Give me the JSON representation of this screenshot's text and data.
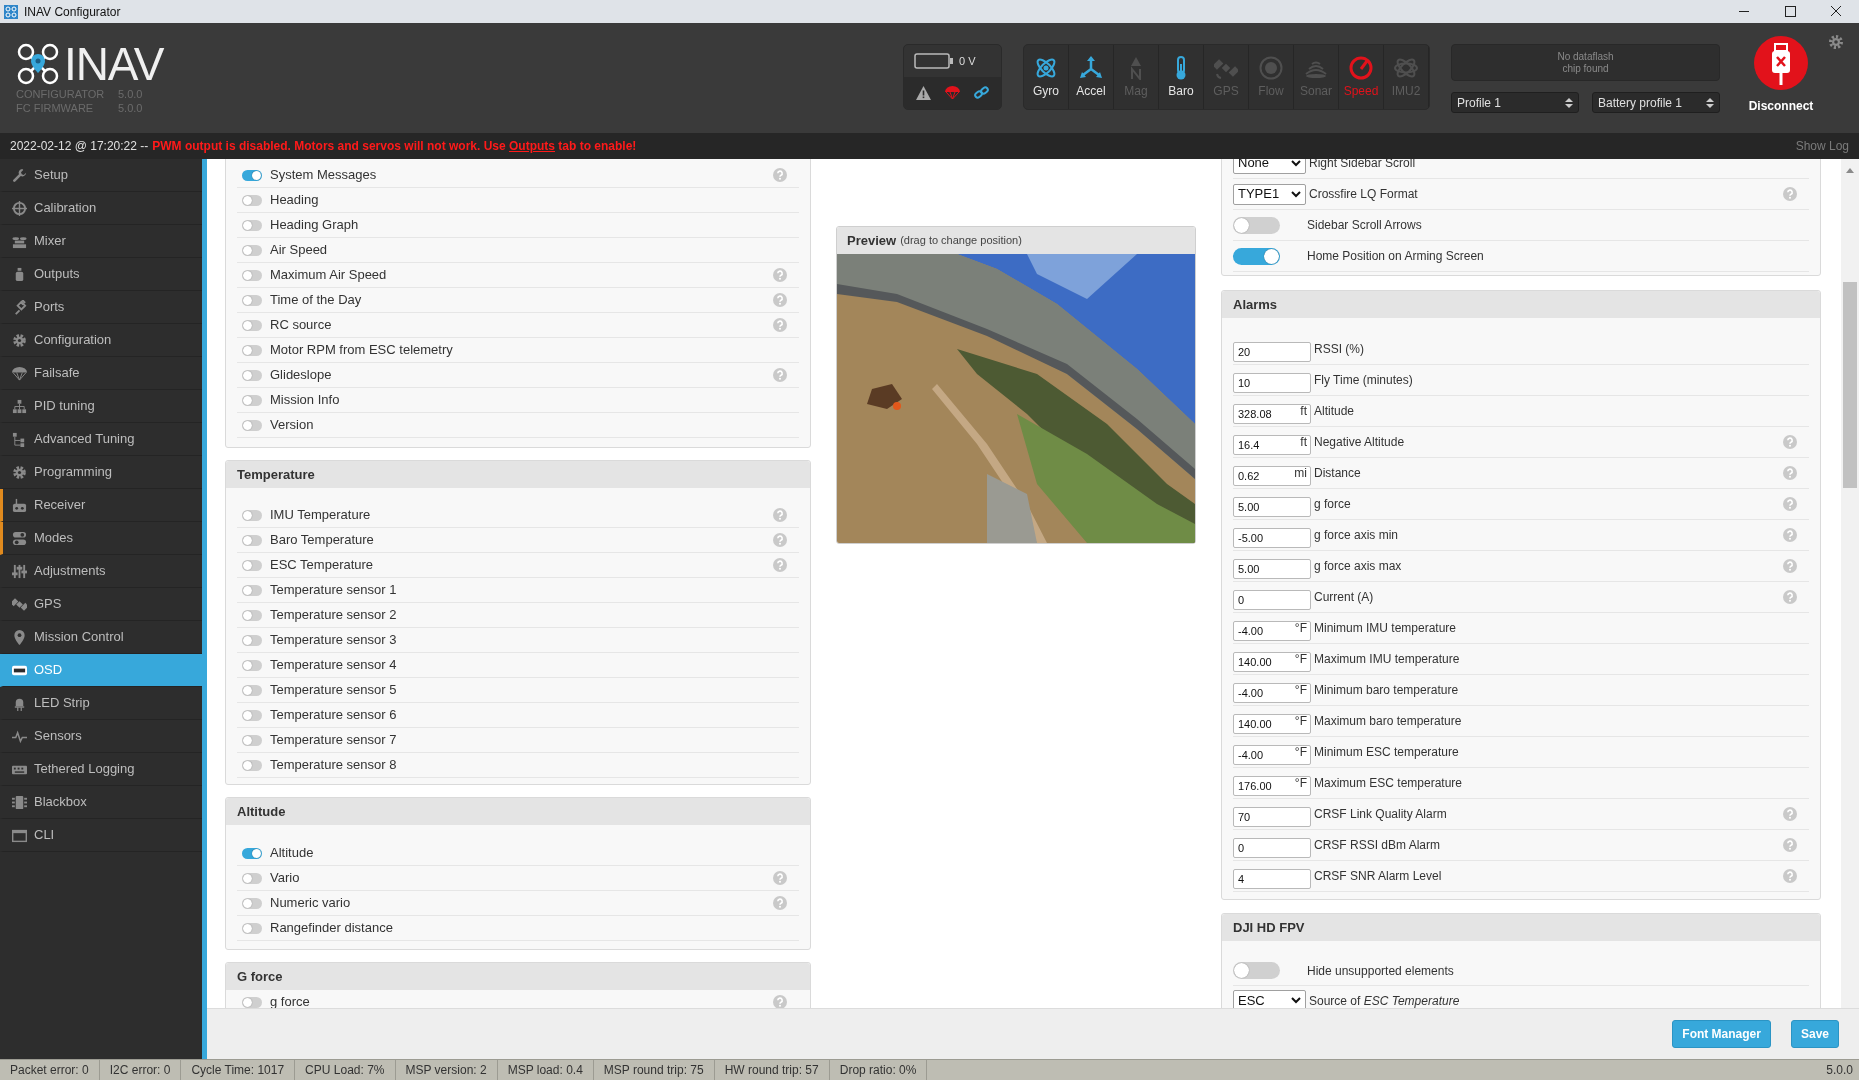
{
  "window": {
    "title": "INAV Configurator"
  },
  "header": {
    "logo_text": "INAV",
    "versions": [
      {
        "label": "CONFIGURATOR",
        "value": "5.0.0"
      },
      {
        "label": "FC FIRMWARE",
        "value": "5.0.0"
      }
    ],
    "battery": {
      "voltage": "0 V"
    },
    "sensors": [
      {
        "label": "Gyro",
        "enabled": true,
        "alert": false
      },
      {
        "label": "Accel",
        "enabled": true,
        "alert": false
      },
      {
        "label": "Mag",
        "enabled": false,
        "alert": false
      },
      {
        "label": "Baro",
        "enabled": true,
        "alert": false
      },
      {
        "label": "GPS",
        "enabled": false,
        "alert": false
      },
      {
        "label": "Flow",
        "enabled": false,
        "alert": false
      },
      {
        "label": "Sonar",
        "enabled": false,
        "alert": false
      },
      {
        "label": "Speed",
        "enabled": true,
        "alert": true
      },
      {
        "label": "IMU2",
        "enabled": false,
        "alert": false
      }
    ],
    "dataflash": "No dataflash chip found",
    "profiles": [
      "Profile 1",
      "Battery profile 1"
    ],
    "disconnect": "Disconnect"
  },
  "log": {
    "time": "2022-02-12 @ 17:20:22 --",
    "message_before": "PWM output is disabled. Motors and servos will not work. Use",
    "link": "Outputs",
    "message_after": "tab to enable!",
    "show_log": "Show Log"
  },
  "sidebar": {
    "items": [
      {
        "label": "Setup",
        "selected": false,
        "flag": false
      },
      {
        "label": "Calibration",
        "selected": false,
        "flag": false
      },
      {
        "label": "Mixer",
        "selected": false,
        "flag": false
      },
      {
        "label": "Outputs",
        "selected": false,
        "flag": false
      },
      {
        "label": "Ports",
        "selected": false,
        "flag": false
      },
      {
        "label": "Configuration",
        "selected": false,
        "flag": false
      },
      {
        "label": "Failsafe",
        "selected": false,
        "flag": false
      },
      {
        "label": "PID tuning",
        "selected": false,
        "flag": false
      },
      {
        "label": "Advanced Tuning",
        "selected": false,
        "flag": false
      },
      {
        "label": "Programming",
        "selected": false,
        "flag": false
      },
      {
        "label": "Receiver",
        "selected": false,
        "flag": true
      },
      {
        "label": "Modes",
        "selected": false,
        "flag": true
      },
      {
        "label": "Adjustments",
        "selected": false,
        "flag": false
      },
      {
        "label": "GPS",
        "selected": false,
        "flag": false
      },
      {
        "label": "Mission Control",
        "selected": false,
        "flag": false
      },
      {
        "label": "OSD",
        "selected": true,
        "flag": false
      },
      {
        "label": "LED Strip",
        "selected": false,
        "flag": false
      },
      {
        "label": "Sensors",
        "selected": false,
        "flag": false
      },
      {
        "label": "Tethered Logging",
        "selected": false,
        "flag": false
      },
      {
        "label": "Blackbox",
        "selected": false,
        "flag": false
      },
      {
        "label": "CLI",
        "selected": false,
        "flag": false
      }
    ]
  },
  "element_groups": [
    {
      "items": [
        {
          "label": "System Messages",
          "on": true,
          "help": true
        },
        {
          "label": "Heading",
          "on": false,
          "help": false
        },
        {
          "label": "Heading Graph",
          "on": false,
          "help": false
        },
        {
          "label": "Air Speed",
          "on": false,
          "help": false
        },
        {
          "label": "Maximum Air Speed",
          "on": false,
          "help": true
        },
        {
          "label": "Time of the Day",
          "on": false,
          "help": true
        },
        {
          "label": "RC source",
          "on": false,
          "help": true
        },
        {
          "label": "Motor RPM from ESC telemetry",
          "on": false,
          "help": false
        },
        {
          "label": "Glideslope",
          "on": false,
          "help": true
        },
        {
          "label": "Mission Info",
          "on": false,
          "help": false
        },
        {
          "label": "Version",
          "on": false,
          "help": false
        }
      ]
    },
    {
      "title": "Temperature",
      "items": [
        {
          "label": "IMU Temperature",
          "on": false,
          "help": true
        },
        {
          "label": "Baro Temperature",
          "on": false,
          "help": true
        },
        {
          "label": "ESC Temperature",
          "on": false,
          "help": true
        },
        {
          "label": "Temperature sensor 1",
          "on": false,
          "help": false
        },
        {
          "label": "Temperature sensor 2",
          "on": false,
          "help": false
        },
        {
          "label": "Temperature sensor 3",
          "on": false,
          "help": false
        },
        {
          "label": "Temperature sensor 4",
          "on": false,
          "help": false
        },
        {
          "label": "Temperature sensor 5",
          "on": false,
          "help": false
        },
        {
          "label": "Temperature sensor 6",
          "on": false,
          "help": false
        },
        {
          "label": "Temperature sensor 7",
          "on": false,
          "help": false
        },
        {
          "label": "Temperature sensor 8",
          "on": false,
          "help": false
        }
      ]
    },
    {
      "title": "Altitude",
      "items": [
        {
          "label": "Altitude",
          "on": true,
          "help": false
        },
        {
          "label": "Vario",
          "on": false,
          "help": true
        },
        {
          "label": "Numeric vario",
          "on": false,
          "help": true
        },
        {
          "label": "Rangefinder distance",
          "on": false,
          "help": false
        }
      ]
    },
    {
      "title": "G force",
      "items": [
        {
          "label": "g force",
          "on": false,
          "help": true
        }
      ]
    }
  ],
  "preview": {
    "title": "Preview",
    "hint": "(drag to change position)",
    "kind": "picture"
  },
  "settings_groups": [
    {
      "items": [
        {
          "kind": "select",
          "value": "None",
          "label": "Right Sidebar Scroll",
          "help": false
        },
        {
          "kind": "select",
          "value": "TYPE1",
          "label": "Crossfire LQ Format",
          "help": true
        },
        {
          "kind": "toggle",
          "on": false,
          "label": "Sidebar Scroll Arrows",
          "help": false
        },
        {
          "kind": "toggle",
          "on": true,
          "label": "Home Position on Arming Screen",
          "help": false
        }
      ]
    },
    {
      "title": "Alarms",
      "items": [
        {
          "kind": "number",
          "value": "20",
          "label": "RSSI (%)",
          "help": false
        },
        {
          "kind": "number",
          "value": "10",
          "label": "Fly Time (minutes)",
          "help": false
        },
        {
          "kind": "number",
          "value": "328.08",
          "unit": "ft",
          "label": "Altitude",
          "help": false
        },
        {
          "kind": "number",
          "value": "16.4",
          "unit": "ft",
          "label": "Negative Altitude",
          "help": true
        },
        {
          "kind": "number",
          "value": "0.62",
          "unit": "mi",
          "label": "Distance",
          "help": true
        },
        {
          "kind": "number",
          "value": "5.00",
          "label": "g force",
          "help": true
        },
        {
          "kind": "number",
          "value": "-5.00",
          "label": "g force axis min",
          "help": true
        },
        {
          "kind": "number",
          "value": "5.00",
          "label": "g force axis max",
          "help": true
        },
        {
          "kind": "number",
          "value": "0",
          "label": "Current (A)",
          "help": true
        },
        {
          "kind": "number",
          "value": "-4.00",
          "unit": "°F",
          "label": "Minimum IMU temperature",
          "help": false
        },
        {
          "kind": "number",
          "value": "140.00",
          "unit": "°F",
          "label": "Maximum IMU temperature",
          "help": false
        },
        {
          "kind": "number",
          "value": "-4.00",
          "unit": "°F",
          "label": "Minimum baro temperature",
          "help": false
        },
        {
          "kind": "number",
          "value": "140.00",
          "unit": "°F",
          "label": "Maximum baro temperature",
          "help": false
        },
        {
          "kind": "number",
          "value": "-4.00",
          "unit": "°F",
          "label": "Minimum ESC temperature",
          "help": false
        },
        {
          "kind": "number",
          "value": "176.00",
          "unit": "°F",
          "label": "Maximum ESC temperature",
          "help": false
        },
        {
          "kind": "number",
          "value": "70",
          "label": "CRSF Link Quality Alarm",
          "help": true
        },
        {
          "kind": "number",
          "value": "0",
          "label": "CRSF RSSI dBm Alarm",
          "help": true
        },
        {
          "kind": "number",
          "value": "4",
          "label": "CRSF SNR Alarm Level",
          "help": true
        }
      ]
    },
    {
      "title": "DJI HD FPV",
      "items": [
        {
          "kind": "toggle",
          "on": false,
          "label": "Hide unsupported elements",
          "help": false
        },
        {
          "kind": "select",
          "value": "ESC",
          "label": "Source of *ESC Temperature*",
          "help": false
        }
      ]
    }
  ],
  "footer_buttons": [
    "Font Manager",
    "Save"
  ],
  "status_bar": {
    "items": [
      "Packet error: 0",
      "I2C error: 0",
      "Cycle Time: 1017",
      "CPU Load: 7%",
      "MSP version: 2",
      "MSP load: 0.4",
      "MSP round trip: 75",
      "HW round trip: 57",
      "Drop ratio: 0%"
    ],
    "version": "5.0.0"
  }
}
